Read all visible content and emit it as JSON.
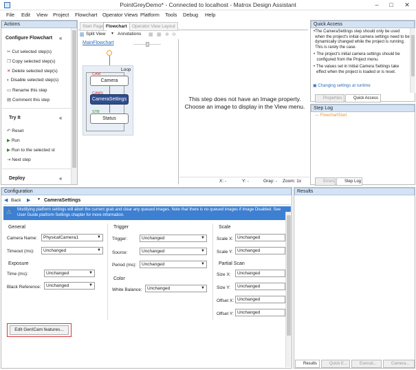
{
  "window": {
    "title": "PointGreyDemo* - Connected to localhost - Matrox Design Assistant",
    "minimize": "–",
    "maximize": "□",
    "close": "✕"
  },
  "menu": [
    "File",
    "Edit",
    "View",
    "Project",
    "Flowchart",
    "Operator Views",
    "Platform",
    "Tools",
    "Debug",
    "Help"
  ],
  "actions": {
    "header": "Actions",
    "configure_title": "Configure Flowchart",
    "configure_items": [
      "Cut selected step(s)",
      "Copy selected step(s)",
      "Delete selected step(s)",
      "Disable selected step(s)",
      "Rename this step",
      "Comment this step"
    ],
    "tryit_title": "Try It",
    "tryit_items": [
      "Reset",
      "Run",
      "Run to the selected st",
      "Next step"
    ],
    "deploy_title": "Deploy",
    "collapse": "«"
  },
  "editor_tabs": [
    "Start Page",
    "Flowchart",
    "Operator View Layout"
  ],
  "toolbar": {
    "split_view": "Split View",
    "annotations": "Annotations"
  },
  "flowchart": {
    "breadcrumb": "MainFlowchart",
    "loop_label": "Loop",
    "nodes": [
      {
        "tag": "CAM",
        "label": "Camera"
      },
      {
        "tag": "CAMS",
        "label": "CameraSettings"
      },
      {
        "tag": "STB",
        "label": "Status"
      }
    ]
  },
  "image_view": {
    "message": "This step does not have an Image property. Choose an image to display in the View menu.",
    "status": {
      "x": "X: -",
      "y": "Y: -",
      "gray": "Gray: -",
      "zoom": "Zoom: 1x"
    }
  },
  "quick_access": {
    "header": "Quick Access",
    "bullets": [
      "The CameraSettings step should only be used when the project's initial camera settings need to be dynamically changed while the project is running. This is rarely the case.",
      "The project's initial camera settings should be configured from the Project menu.",
      "The values set in Initial Camera Settings take effect when the project is loaded or is reset."
    ],
    "link": "Changing settings at runtime",
    "tabs": [
      "Properties",
      "Quick Access"
    ]
  },
  "step_log": {
    "header": "Step Log",
    "entry": "— FlowchartStart",
    "tabs": [
      "Errors",
      "Step Log"
    ]
  },
  "configuration": {
    "header": "Configuration",
    "back": "Back",
    "step_name": "CameraSettings",
    "warning": "Modifying platform settings will abort the current grab and clear any queued images. Note that there is no queued images if Image Disabled. See User Guide platform Settings chapter for more information.",
    "general": {
      "title": "General",
      "camera_name_label": "Camera Name:",
      "camera_name_value": "PhysicalCamera1",
      "timeout_label": "Timeout (ms):",
      "timeout_value": "Unchanged"
    },
    "exposure": {
      "title": "Exposure",
      "time_label": "Time (ms):",
      "time_value": "Unchanged",
      "black_label": "Black Reference:",
      "black_value": "Unchanged"
    },
    "trigger": {
      "title": "Trigger",
      "trigger_label": "Trigger:",
      "trigger_value": "Unchanged",
      "source_label": "Source:",
      "source_value": "Unchanged",
      "period_label": "Period (ms):",
      "period_value": "Unchanged"
    },
    "color": {
      "title": "Color",
      "wb_label": "White Balance:",
      "wb_value": "Unchanged"
    },
    "scale": {
      "title": "Scale",
      "sx_label": "Scale X:",
      "sx_value": "Unchanged",
      "sy_label": "Scale Y:",
      "sy_value": "Unchanged"
    },
    "partial": {
      "title": "Partial Scan",
      "szx_label": "Size X:",
      "szx_value": "Unchanged",
      "szy_label": "Size Y:",
      "szy_value": "Unchanged",
      "ox_label": "Offset X:",
      "ox_value": "Unchanged",
      "oy_label": "Offset Y:",
      "oy_value": "Unchanged"
    },
    "genicam_button": "Edit GenICam features..."
  },
  "results": {
    "header": "Results",
    "tabs": [
      "Results",
      "Quick E...",
      "Executi...",
      "Camera..."
    ]
  },
  "colors": {
    "accent": "#2a6cb5",
    "warning_bg": "#3d7fd1",
    "highlight": "#d33"
  }
}
